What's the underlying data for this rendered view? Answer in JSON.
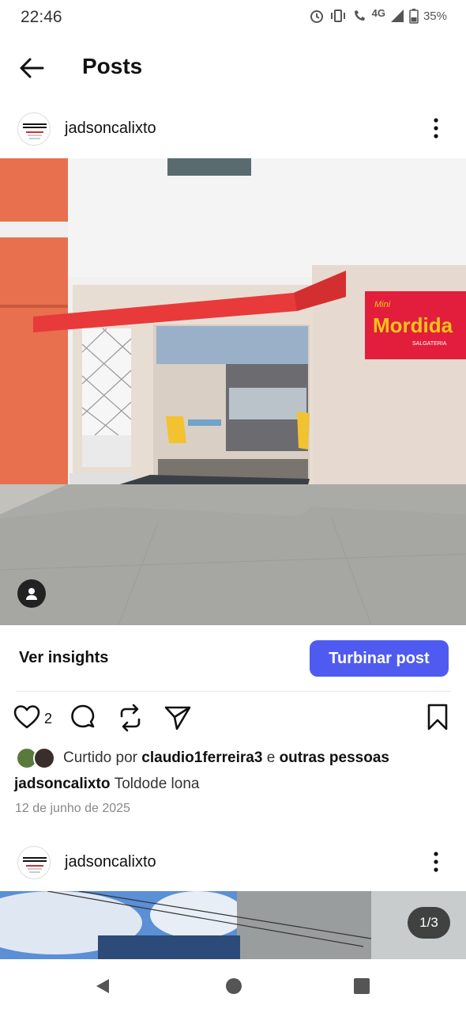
{
  "status_bar": {
    "time": "22:46",
    "network": "4G",
    "battery": "35%"
  },
  "header": {
    "title": "Posts"
  },
  "post": {
    "username": "jadsoncalixto",
    "image_sign_top": "Mini",
    "image_sign_main": "Mordida",
    "image_sign_sub": "SALGATERIA",
    "insights_label": "Ver insights",
    "boost_label": "Turbinar post",
    "like_count": "2",
    "liked_by_prefix": "Curtido por",
    "liked_by_user": "claudio1ferreira3",
    "liked_by_middle": "e",
    "liked_by_suffix": "outras pessoas",
    "caption_user": "jadsoncalixto",
    "caption_text": "Toldode lona",
    "date": "12 de junho de 2025"
  },
  "next_post": {
    "username": "jadsoncalixto",
    "carousel_counter": "1/3"
  },
  "colors": {
    "boost": "#4f5bf0",
    "awning": "#e83a3a",
    "sign": "#e21e3c",
    "sign_text": "#f5c518"
  }
}
